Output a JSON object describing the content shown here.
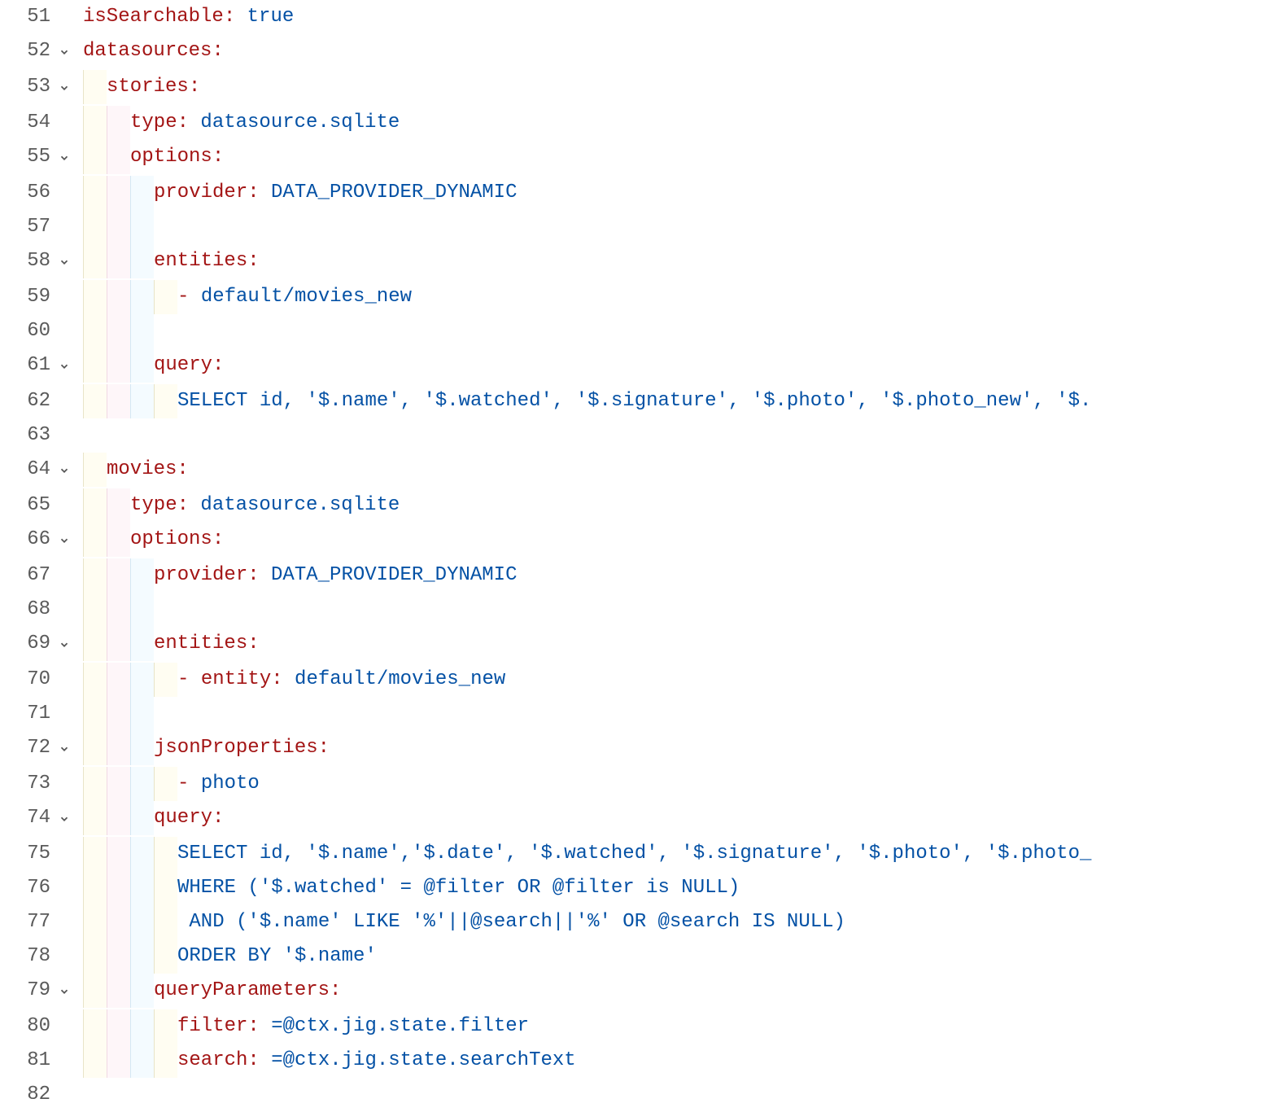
{
  "colors": {
    "key": "#a31515",
    "value": "#0451a5"
  },
  "lines": [
    {
      "num": 51,
      "fold": false,
      "indent": 0,
      "tokens": [
        [
          "key",
          "isSearchable"
        ],
        [
          "punct",
          ":"
        ],
        [
          "plain",
          " "
        ],
        [
          "value",
          "true"
        ]
      ]
    },
    {
      "num": 52,
      "fold": true,
      "indent": 0,
      "tokens": [
        [
          "key",
          "datasources"
        ],
        [
          "punct",
          ":"
        ]
      ]
    },
    {
      "num": 53,
      "fold": true,
      "indent": 1,
      "tokens": [
        [
          "key",
          "stories"
        ],
        [
          "punct",
          ":"
        ]
      ]
    },
    {
      "num": 54,
      "fold": false,
      "indent": 2,
      "tokens": [
        [
          "key",
          "type"
        ],
        [
          "punct",
          ":"
        ],
        [
          "plain",
          " "
        ],
        [
          "value",
          "datasource.sqlite"
        ]
      ]
    },
    {
      "num": 55,
      "fold": true,
      "indent": 2,
      "tokens": [
        [
          "key",
          "options"
        ],
        [
          "punct",
          ":"
        ]
      ]
    },
    {
      "num": 56,
      "fold": false,
      "indent": 3,
      "tokens": [
        [
          "key",
          "provider"
        ],
        [
          "punct",
          ":"
        ],
        [
          "plain",
          " "
        ],
        [
          "value",
          "DATA_PROVIDER_DYNAMIC"
        ]
      ]
    },
    {
      "num": 57,
      "fold": false,
      "indent": 3,
      "tokens": []
    },
    {
      "num": 58,
      "fold": true,
      "indent": 3,
      "tokens": [
        [
          "key",
          "entities"
        ],
        [
          "punct",
          ":"
        ]
      ]
    },
    {
      "num": 59,
      "fold": false,
      "indent": 4,
      "tokens": [
        [
          "punct",
          "- "
        ],
        [
          "value",
          "default/movies_new"
        ]
      ]
    },
    {
      "num": 60,
      "fold": false,
      "indent": 3,
      "tokens": []
    },
    {
      "num": 61,
      "fold": true,
      "indent": 3,
      "tokens": [
        [
          "key",
          "query"
        ],
        [
          "punct",
          ":"
        ]
      ]
    },
    {
      "num": 62,
      "fold": false,
      "indent": 4,
      "tokens": [
        [
          "value",
          "SELECT id, '$.name', '$.watched', '$.signature', '$.photo', '$.photo_new', '$."
        ]
      ]
    },
    {
      "num": 63,
      "fold": false,
      "indent": 0,
      "tokens": []
    },
    {
      "num": 64,
      "fold": true,
      "indent": 1,
      "tokens": [
        [
          "key",
          "movies"
        ],
        [
          "punct",
          ":"
        ]
      ]
    },
    {
      "num": 65,
      "fold": false,
      "indent": 2,
      "tokens": [
        [
          "key",
          "type"
        ],
        [
          "punct",
          ":"
        ],
        [
          "plain",
          " "
        ],
        [
          "value",
          "datasource.sqlite"
        ]
      ]
    },
    {
      "num": 66,
      "fold": true,
      "indent": 2,
      "tokens": [
        [
          "key",
          "options"
        ],
        [
          "punct",
          ":"
        ]
      ]
    },
    {
      "num": 67,
      "fold": false,
      "indent": 3,
      "tokens": [
        [
          "key",
          "provider"
        ],
        [
          "punct",
          ":"
        ],
        [
          "plain",
          " "
        ],
        [
          "value",
          "DATA_PROVIDER_DYNAMIC"
        ]
      ]
    },
    {
      "num": 68,
      "fold": false,
      "indent": 3,
      "tokens": []
    },
    {
      "num": 69,
      "fold": true,
      "indent": 3,
      "tokens": [
        [
          "key",
          "entities"
        ],
        [
          "punct",
          ":"
        ]
      ]
    },
    {
      "num": 70,
      "fold": false,
      "indent": 4,
      "tokens": [
        [
          "punct",
          "- "
        ],
        [
          "key",
          "entity"
        ],
        [
          "punct",
          ":"
        ],
        [
          "plain",
          " "
        ],
        [
          "value",
          "default/movies_new"
        ]
      ]
    },
    {
      "num": 71,
      "fold": false,
      "indent": 3,
      "tokens": []
    },
    {
      "num": 72,
      "fold": true,
      "indent": 3,
      "tokens": [
        [
          "key",
          "jsonProperties"
        ],
        [
          "punct",
          ":"
        ]
      ]
    },
    {
      "num": 73,
      "fold": false,
      "indent": 4,
      "tokens": [
        [
          "punct",
          "- "
        ],
        [
          "value",
          "photo"
        ]
      ]
    },
    {
      "num": 74,
      "fold": true,
      "indent": 3,
      "tokens": [
        [
          "key",
          "query"
        ],
        [
          "punct",
          ":"
        ]
      ]
    },
    {
      "num": 75,
      "fold": false,
      "indent": 4,
      "tokens": [
        [
          "value",
          "SELECT id, '$.name','$.date', '$.watched', '$.signature', '$.photo', '$.photo_"
        ]
      ]
    },
    {
      "num": 76,
      "fold": false,
      "indent": 4,
      "tokens": [
        [
          "value",
          "WHERE ('$.watched' = @filter OR @filter is NULL)"
        ]
      ]
    },
    {
      "num": 77,
      "fold": false,
      "indent": 4,
      "tokens": [
        [
          "value",
          "  AND ('$.name' LIKE '%'||@search||'%' OR @search IS NULL)"
        ]
      ]
    },
    {
      "num": 78,
      "fold": false,
      "indent": 4,
      "tokens": [
        [
          "value",
          "ORDER BY '$.name'"
        ]
      ]
    },
    {
      "num": 79,
      "fold": true,
      "indent": 3,
      "tokens": [
        [
          "key",
          "queryParameters"
        ],
        [
          "punct",
          ":"
        ]
      ]
    },
    {
      "num": 80,
      "fold": false,
      "indent": 4,
      "tokens": [
        [
          "key",
          "filter"
        ],
        [
          "punct",
          ":"
        ],
        [
          "plain",
          " "
        ],
        [
          "value",
          "=@ctx.jig.state.filter"
        ]
      ]
    },
    {
      "num": 81,
      "fold": false,
      "indent": 4,
      "tokens": [
        [
          "key",
          "search"
        ],
        [
          "punct",
          ":"
        ],
        [
          "plain",
          " "
        ],
        [
          "value",
          "=@ctx.jig.state.searchText"
        ]
      ]
    },
    {
      "num": 82,
      "fold": false,
      "indent": 0,
      "tokens": []
    }
  ]
}
